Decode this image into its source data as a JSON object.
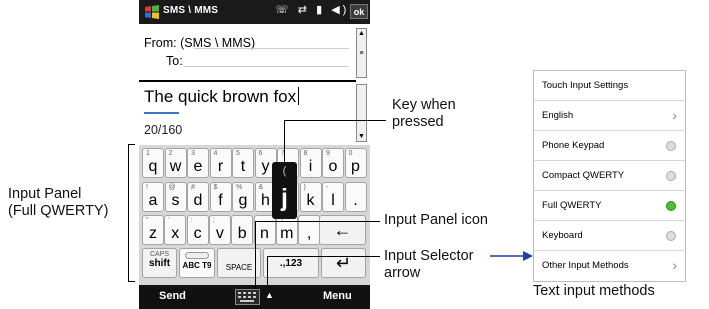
{
  "status_bar": {
    "title": "SMS \\ MMS",
    "icons": "☏ ⇄ ▮ ◀)",
    "ok_label": "ok"
  },
  "compose": {
    "from": "From: (SMS \\ MMS)",
    "to": "To:",
    "body": "The quick brown fox",
    "counter": "20/160"
  },
  "keyboard": {
    "row1": [
      {
        "top": "1",
        "main": "q"
      },
      {
        "top": "2",
        "main": "w"
      },
      {
        "top": "3",
        "main": "e"
      },
      {
        "top": "4",
        "main": "r"
      },
      {
        "top": "5",
        "main": "t"
      },
      {
        "top": "6",
        "main": "y"
      },
      {
        "top": "7",
        "main": "u"
      },
      {
        "top": "8",
        "main": "i"
      },
      {
        "top": "9",
        "main": "o"
      },
      {
        "top": "0",
        "main": "p"
      }
    ],
    "row2": [
      {
        "top": "!",
        "main": "a"
      },
      {
        "top": "@",
        "main": "s"
      },
      {
        "top": "#",
        "main": "d"
      },
      {
        "top": "$",
        "main": "f"
      },
      {
        "top": "%",
        "main": "g"
      },
      {
        "top": "&",
        "main": "h"
      },
      {
        "top": "*",
        "main": "j"
      },
      {
        "top": ")",
        "main": "k"
      },
      {
        "top": "-",
        "main": "l"
      },
      {
        "top": "",
        "main": "."
      }
    ],
    "row3": [
      {
        "top": "\"",
        "main": "z"
      },
      {
        "top": "'",
        "main": "x"
      },
      {
        "top": ":",
        "main": "c"
      },
      {
        "top": ";",
        "main": "v"
      },
      {
        "top": "",
        "main": "b"
      },
      {
        "top": "",
        "main": "n"
      },
      {
        "top": "?",
        "main": "m"
      },
      {
        "top": "",
        "main": ","
      }
    ],
    "backspace": "←",
    "caps_label": "CAPS",
    "shift_label": "shift",
    "abc_label": "ABC T9",
    "space_label": "SPACE",
    "num_label": ".,123",
    "enter": "↵",
    "popup_symbol": "(",
    "popup_key": "j"
  },
  "menu_bar": {
    "send": "Send",
    "menu": "Menu",
    "selector_arrow": "▲"
  },
  "callouts": {
    "key_pressed": [
      "Key when",
      "pressed"
    ],
    "input_panel": [
      "Input Panel",
      "(Full QWERTY)"
    ],
    "input_panel_icon": "Input Panel icon",
    "input_selector": [
      "Input Selector",
      "arrow"
    ],
    "text_input_methods": "Text input methods"
  },
  "input_methods": [
    {
      "label": "Touch Input Settings",
      "control": "none"
    },
    {
      "label": "English",
      "control": "chevron"
    },
    {
      "label": "Phone Keypad",
      "control": "radio-off"
    },
    {
      "label": "Compact QWERTY",
      "control": "radio-off"
    },
    {
      "label": "Full QWERTY",
      "control": "radio-on"
    },
    {
      "label": "Keyboard",
      "control": "radio-off"
    },
    {
      "label": "Other Input Methods",
      "control": "chevron"
    }
  ],
  "colors": {
    "radio_selected": "#4cbf2e",
    "underline": "#3a78c6"
  }
}
